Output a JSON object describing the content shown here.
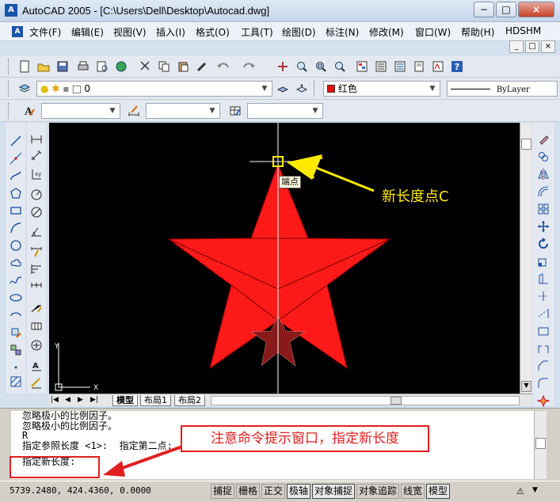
{
  "window": {
    "title": "AutoCAD 2005 - [C:\\Users\\Dell\\Desktop\\Autocad.dwg]",
    "app_icon": "A",
    "buttons": [
      "−",
      "□",
      "×"
    ]
  },
  "menu": {
    "items": [
      "文件(F)",
      "编辑(E)",
      "视图(V)",
      "插入(I)",
      "格式(O)",
      "工具(T)",
      "绘图(D)",
      "标注(N)",
      "修改(M)",
      "窗口(W)",
      "帮助(H)",
      "HDSHM"
    ],
    "mdi_buttons": [
      "_",
      "□",
      "×"
    ]
  },
  "layers": {
    "current_layer": "0",
    "color": "红色",
    "color_swatch": "#e01010",
    "linetype": "ByLayer"
  },
  "canvas": {
    "background": "#000000",
    "star_color": "#ff1a1a",
    "tooltip": "端点",
    "ucs_x": "X",
    "ucs_y": "Y"
  },
  "tabs": [
    "模型",
    "布局1",
    "布局2"
  ],
  "command": {
    "lines": [
      "忽略极小的比例因子。",
      "忽略极小的比例因子。",
      "R",
      "指定参照长度 <1>:  指定第二点:",
      "指定新长度:"
    ]
  },
  "status": {
    "coords": "5739.2480, 424.4360, 0.0000",
    "buttons": [
      {
        "label": "捕捉",
        "on": false
      },
      {
        "label": "栅格",
        "on": false
      },
      {
        "label": "正交",
        "on": false
      },
      {
        "label": "极轴",
        "on": true
      },
      {
        "label": "对象捕捉",
        "on": true
      },
      {
        "label": "对象追踪",
        "on": false
      },
      {
        "label": "线宽",
        "on": false
      },
      {
        "label": "模型",
        "on": true
      }
    ]
  },
  "annotations": {
    "point_label": "新长度点C",
    "command_note": "注意命令提示窗口，指定新长度",
    "accent": "#e02020",
    "highlight": "#ffea00"
  }
}
